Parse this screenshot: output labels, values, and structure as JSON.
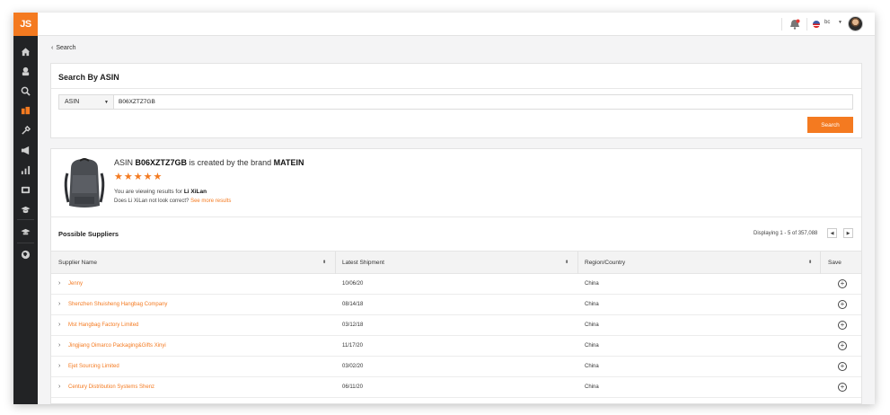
{
  "brand": {
    "logo_text": "JS",
    "accent": "#f47a20"
  },
  "topbar": {
    "lang": "bc"
  },
  "nav": {
    "back_label": "Search"
  },
  "search": {
    "title": "Search By ASIN",
    "type_value": "ASIN",
    "query": "B06XZTZ7GB",
    "button_label": "Search"
  },
  "result": {
    "headline_prefix": "ASIN",
    "asin": "B06XZTZ7GB",
    "headline_mid": "is created by the brand",
    "brand": "MATEIN",
    "rating_stars": 5,
    "viewing_prefix": "You are viewing results for",
    "viewing_name": "Li XiLan",
    "correct_prefix": "Does Li XiLan not look correct?",
    "correct_link": "See more results"
  },
  "suppliers": {
    "title": "Possible Suppliers",
    "displaying": "Displaying 1 - 5 of 357,088",
    "columns": [
      "Supplier Name",
      "Latest Shipment",
      "Region/Country",
      "Save"
    ],
    "rows": [
      {
        "name": "Jenny",
        "shipment": "10/06/20",
        "region": "China"
      },
      {
        "name": "Shenzhen Shuisheng Hangbag Company",
        "shipment": "08/14/18",
        "region": "China"
      },
      {
        "name": "Mst Hangbag Factory Limited",
        "shipment": "03/12/18",
        "region": "China"
      },
      {
        "name": "Jingjiang Oimarco Packaging&Gifts Xinyi",
        "shipment": "11/17/20",
        "region": "China"
      },
      {
        "name": "Ejet Sourcing Limited",
        "shipment": "03/02/20",
        "region": "China"
      },
      {
        "name": "Century Distribution Systems Shenz",
        "shipment": "06/11/20",
        "region": "China"
      }
    ]
  }
}
